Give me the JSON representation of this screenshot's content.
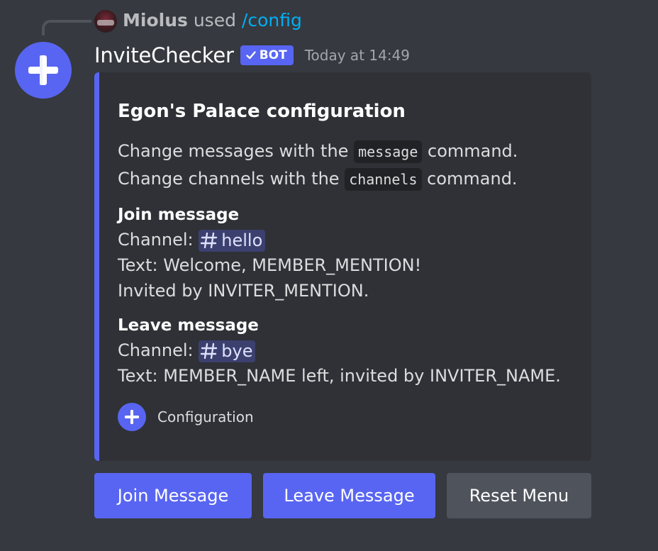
{
  "reply": {
    "user": "Miolus",
    "used": "used",
    "command": "/config"
  },
  "message": {
    "author": "InviteChecker",
    "bot_tag": "BOT",
    "timestamp": "Today at 14:49"
  },
  "embed": {
    "accent_color": "#5865f2",
    "title": "Egon's Palace configuration",
    "description": [
      {
        "before": "Change messages with the ",
        "code": "message",
        "after": " command."
      },
      {
        "before": "Change channels with the ",
        "code": "channels",
        "after": " command."
      }
    ],
    "fields": [
      {
        "name": "Join message",
        "channel_label": "Channel: ",
        "channel": "hello",
        "lines": [
          "Text: Welcome, MEMBER_MENTION!",
          "Invited by INVITER_MENTION."
        ]
      },
      {
        "name": "Leave message",
        "channel_label": "Channel: ",
        "channel": "bye",
        "lines": [
          "Text: MEMBER_NAME left, invited by INVITER_NAME."
        ]
      }
    ],
    "footer": "Configuration"
  },
  "buttons": {
    "join": "Join Message",
    "leave": "Leave Message",
    "reset": "Reset Menu"
  },
  "colors": {
    "background": "#36393f",
    "embed_bg": "#2f3136",
    "blurple": "#5865f2",
    "secondary_button": "#4f545c",
    "link": "#00aff4"
  },
  "icons": {
    "bot_avatar": "plus-icon",
    "bot_check": "check-icon",
    "channel": "hash-icon"
  }
}
